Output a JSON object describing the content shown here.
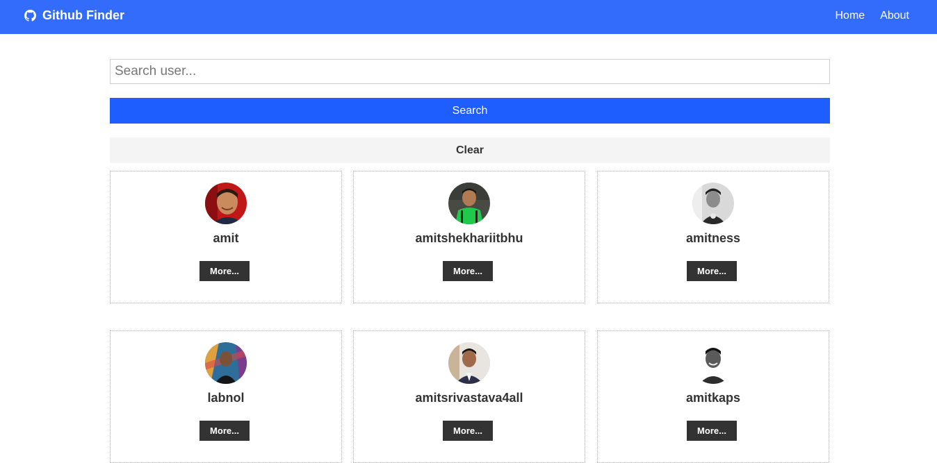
{
  "navbar": {
    "brand_icon": "github-icon",
    "brand": "Github Finder",
    "links": [
      "Home",
      "About"
    ]
  },
  "search": {
    "placeholder": "Search user...",
    "value": "",
    "search_label": "Search",
    "clear_label": "Clear"
  },
  "users": [
    {
      "login": "amit",
      "more_label": "More..."
    },
    {
      "login": "amitshekhariitbhu",
      "more_label": "More..."
    },
    {
      "login": "amitness",
      "more_label": "More..."
    },
    {
      "login": "labnol",
      "more_label": "More..."
    },
    {
      "login": "amitsrivastava4all",
      "more_label": "More..."
    },
    {
      "login": "amitkaps",
      "more_label": "More..."
    }
  ],
  "colors": {
    "navbar": "#336cfb",
    "search_button": "#1e5eff",
    "clear_button": "#f4f4f4",
    "more_button": "#333333"
  }
}
